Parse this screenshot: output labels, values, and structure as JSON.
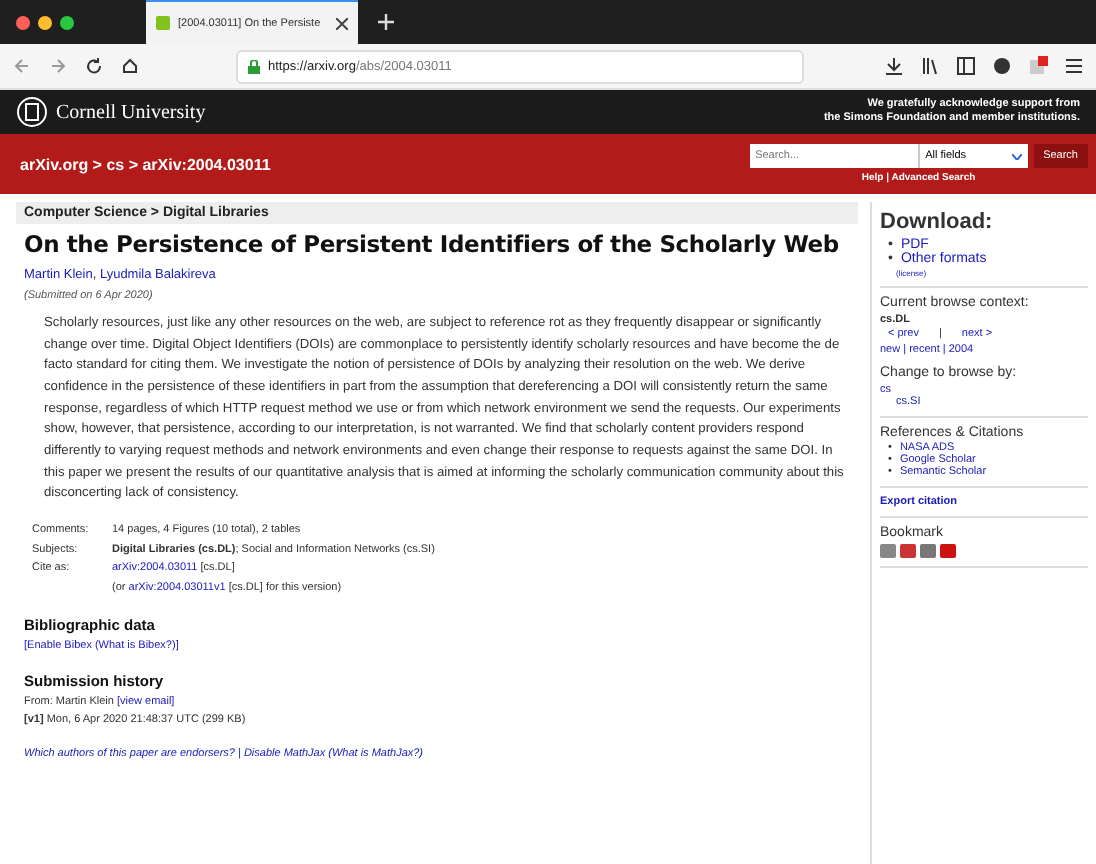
{
  "browser": {
    "tab_title": "[2004.03011] On the Persiste",
    "url_host": "https://arxiv.org",
    "url_path": "/abs/2004.03011"
  },
  "header": {
    "institution": "Cornell University",
    "support": [
      "We gratefully acknowledge support from",
      "the Simons Foundation and member institutions."
    ]
  },
  "nav": {
    "breadcrumb": "arXiv.org > cs > arXiv:2004.03011",
    "search": {
      "placeholder": "Search..."
    },
    "field_select": "All fields",
    "search_button": "Search",
    "help_links": "Help | Advanced Search"
  },
  "paper": {
    "subject": "Computer Science > Digital Libraries",
    "title": "On the Persistence of Persistent Identifiers of the Scholarly Web",
    "authors": [
      "Martin Klein",
      "Lyudmila Balakireva"
    ],
    "author_separator": ",",
    "submitted": "(Submitted on 6 Apr 2020)",
    "abstract": "Scholarly resources, just like any other resources on the web, are subject to reference rot as they frequently disappear or significantly change over time. Digital Object Identifiers (DOIs) are commonplace to persistently identify scholarly resources and have become the de facto standard for citing them. We investigate the notion of persistence of DOIs by analyzing their resolution on the web. We derive confidence in the persistence of these identifiers in part from the assumption that dereferencing a DOI will consistently return the same response, regardless of which HTTP request method we use or from which network environment we send the requests. Our experiments show, however, that persistence, according to our interpretation, is not warranted. We find that scholarly content providers respond differently to varying request methods and network environments and even change their response to requests against the same DOI. In this paper we present the results of our quantitative analysis that is aimed at informing the scholarly communication community about this disconcerting lack of consistency.",
    "metadata": [
      {
        "label": "Comments:",
        "value": "14 pages, 4 Figures (10 total), 2 tables"
      },
      {
        "label": "Subjects:",
        "value": "**Digital Libraries (cs.DL)**; Social and Information Networks (cs.SI)"
      },
      {
        "label": "Cite as:",
        "link": "arXiv:2004.03011",
        "value": "[cs.DL]"
      },
      {
        "prefix": "(or",
        "link": "arXiv:2004.03011v1",
        "value": "[cs.DL] for this version)"
      }
    ],
    "bib_heading": "Bibliographic data",
    "bib_link": "[Enable Bibex (What is Bibex?)]",
    "history_heading": "Submission history",
    "from": "From: Martin Klein",
    "view_email": "[view email]",
    "version": "[v1]",
    "version_date": "Mon, 6 Apr 2020 21:48:37 UTC (299 KB)",
    "footer_links": "Which authors of this paper are endorsers? | Disable MathJax (What is MathJax?)"
  },
  "sidebar": {
    "download_heading": "Download:",
    "downloads": [
      "PDF",
      "Other formats"
    ],
    "license": "(license)",
    "context_heading": "Current browse context:",
    "context": "cs.DL",
    "prev": "< prev",
    "sep": "|",
    "next": "next >",
    "recent": "new | recent | 2004",
    "change_heading": "Change to browse by:",
    "bullet": "•",
    "browse": [
      {
        "label": "cs",
        "children": [
          {
            "label": "cs.SI"
          }
        ]
      }
    ],
    "refs_heading": "References & Citations",
    "refs": [
      "NASA ADS",
      "Google Scholar",
      "Semantic Scholar"
    ],
    "export": "Export citation",
    "bookmark_heading": "Bookmark"
  }
}
